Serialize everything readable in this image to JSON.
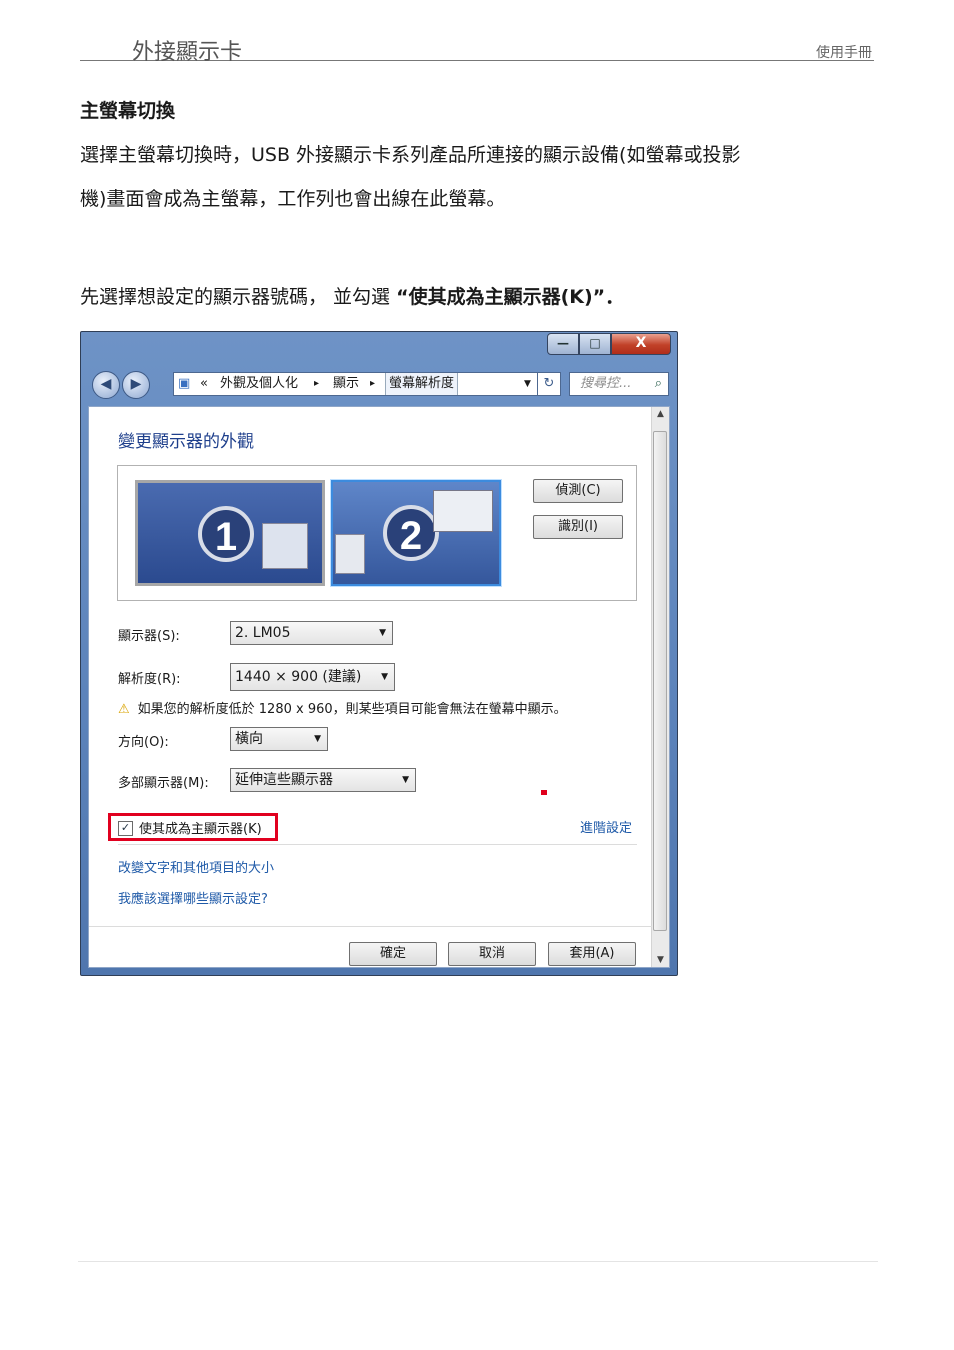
{
  "header": {
    "left": "外接顯示卡",
    "right": "使用手冊"
  },
  "section_title": "主螢幕切換",
  "paragraph1": [
    "選擇主螢幕切換時，USB 外接顯示卡系列產品所連接的顯示設備(如螢幕或投影",
    "機)畫面會成為主螢幕，工作列也會出線在此螢幕。"
  ],
  "paragraph2": {
    "lead": "先選擇想設定的顯示器號碼， 並勾選 ",
    "bold": "“使其成為主顯示器(K)”．"
  },
  "window": {
    "buttons": {
      "minimize": "—",
      "maximize": "□",
      "close": "X"
    },
    "address": {
      "chevron": "«",
      "crumbs": [
        "外觀及個人化",
        "顯示",
        "螢幕解析度"
      ],
      "sep": "▸"
    },
    "search_placeholder": "搜尋控...",
    "title": "變更顯示器的外觀",
    "monitors": [
      "1",
      "2"
    ],
    "detect_button": "偵測(C)",
    "identify_button": "識別(I)",
    "display_label": "顯示器(S):",
    "display_value": "2. LM05",
    "resolution_label": "解析度(R):",
    "resolution_value": "1440 × 900 (建議)",
    "warning_text": "如果您的解析度低於 1280 x 960，則某些項目可能會無法在螢幕中顯示。",
    "orientation_label": "方向(O):",
    "orientation_value": "橫向",
    "multi_label": "多部顯示器(M):",
    "multi_value": "延伸這些顯示器",
    "primary_checkbox_label": "使其成為主顯示器(K)",
    "primary_checked": true,
    "advanced_link": "進階設定",
    "link1": "改變文字和其他項目的大小",
    "link2": "我應該選擇哪些顯示設定?",
    "ok_button": "確定",
    "cancel_button": "取消",
    "apply_button": "套用(A)"
  }
}
